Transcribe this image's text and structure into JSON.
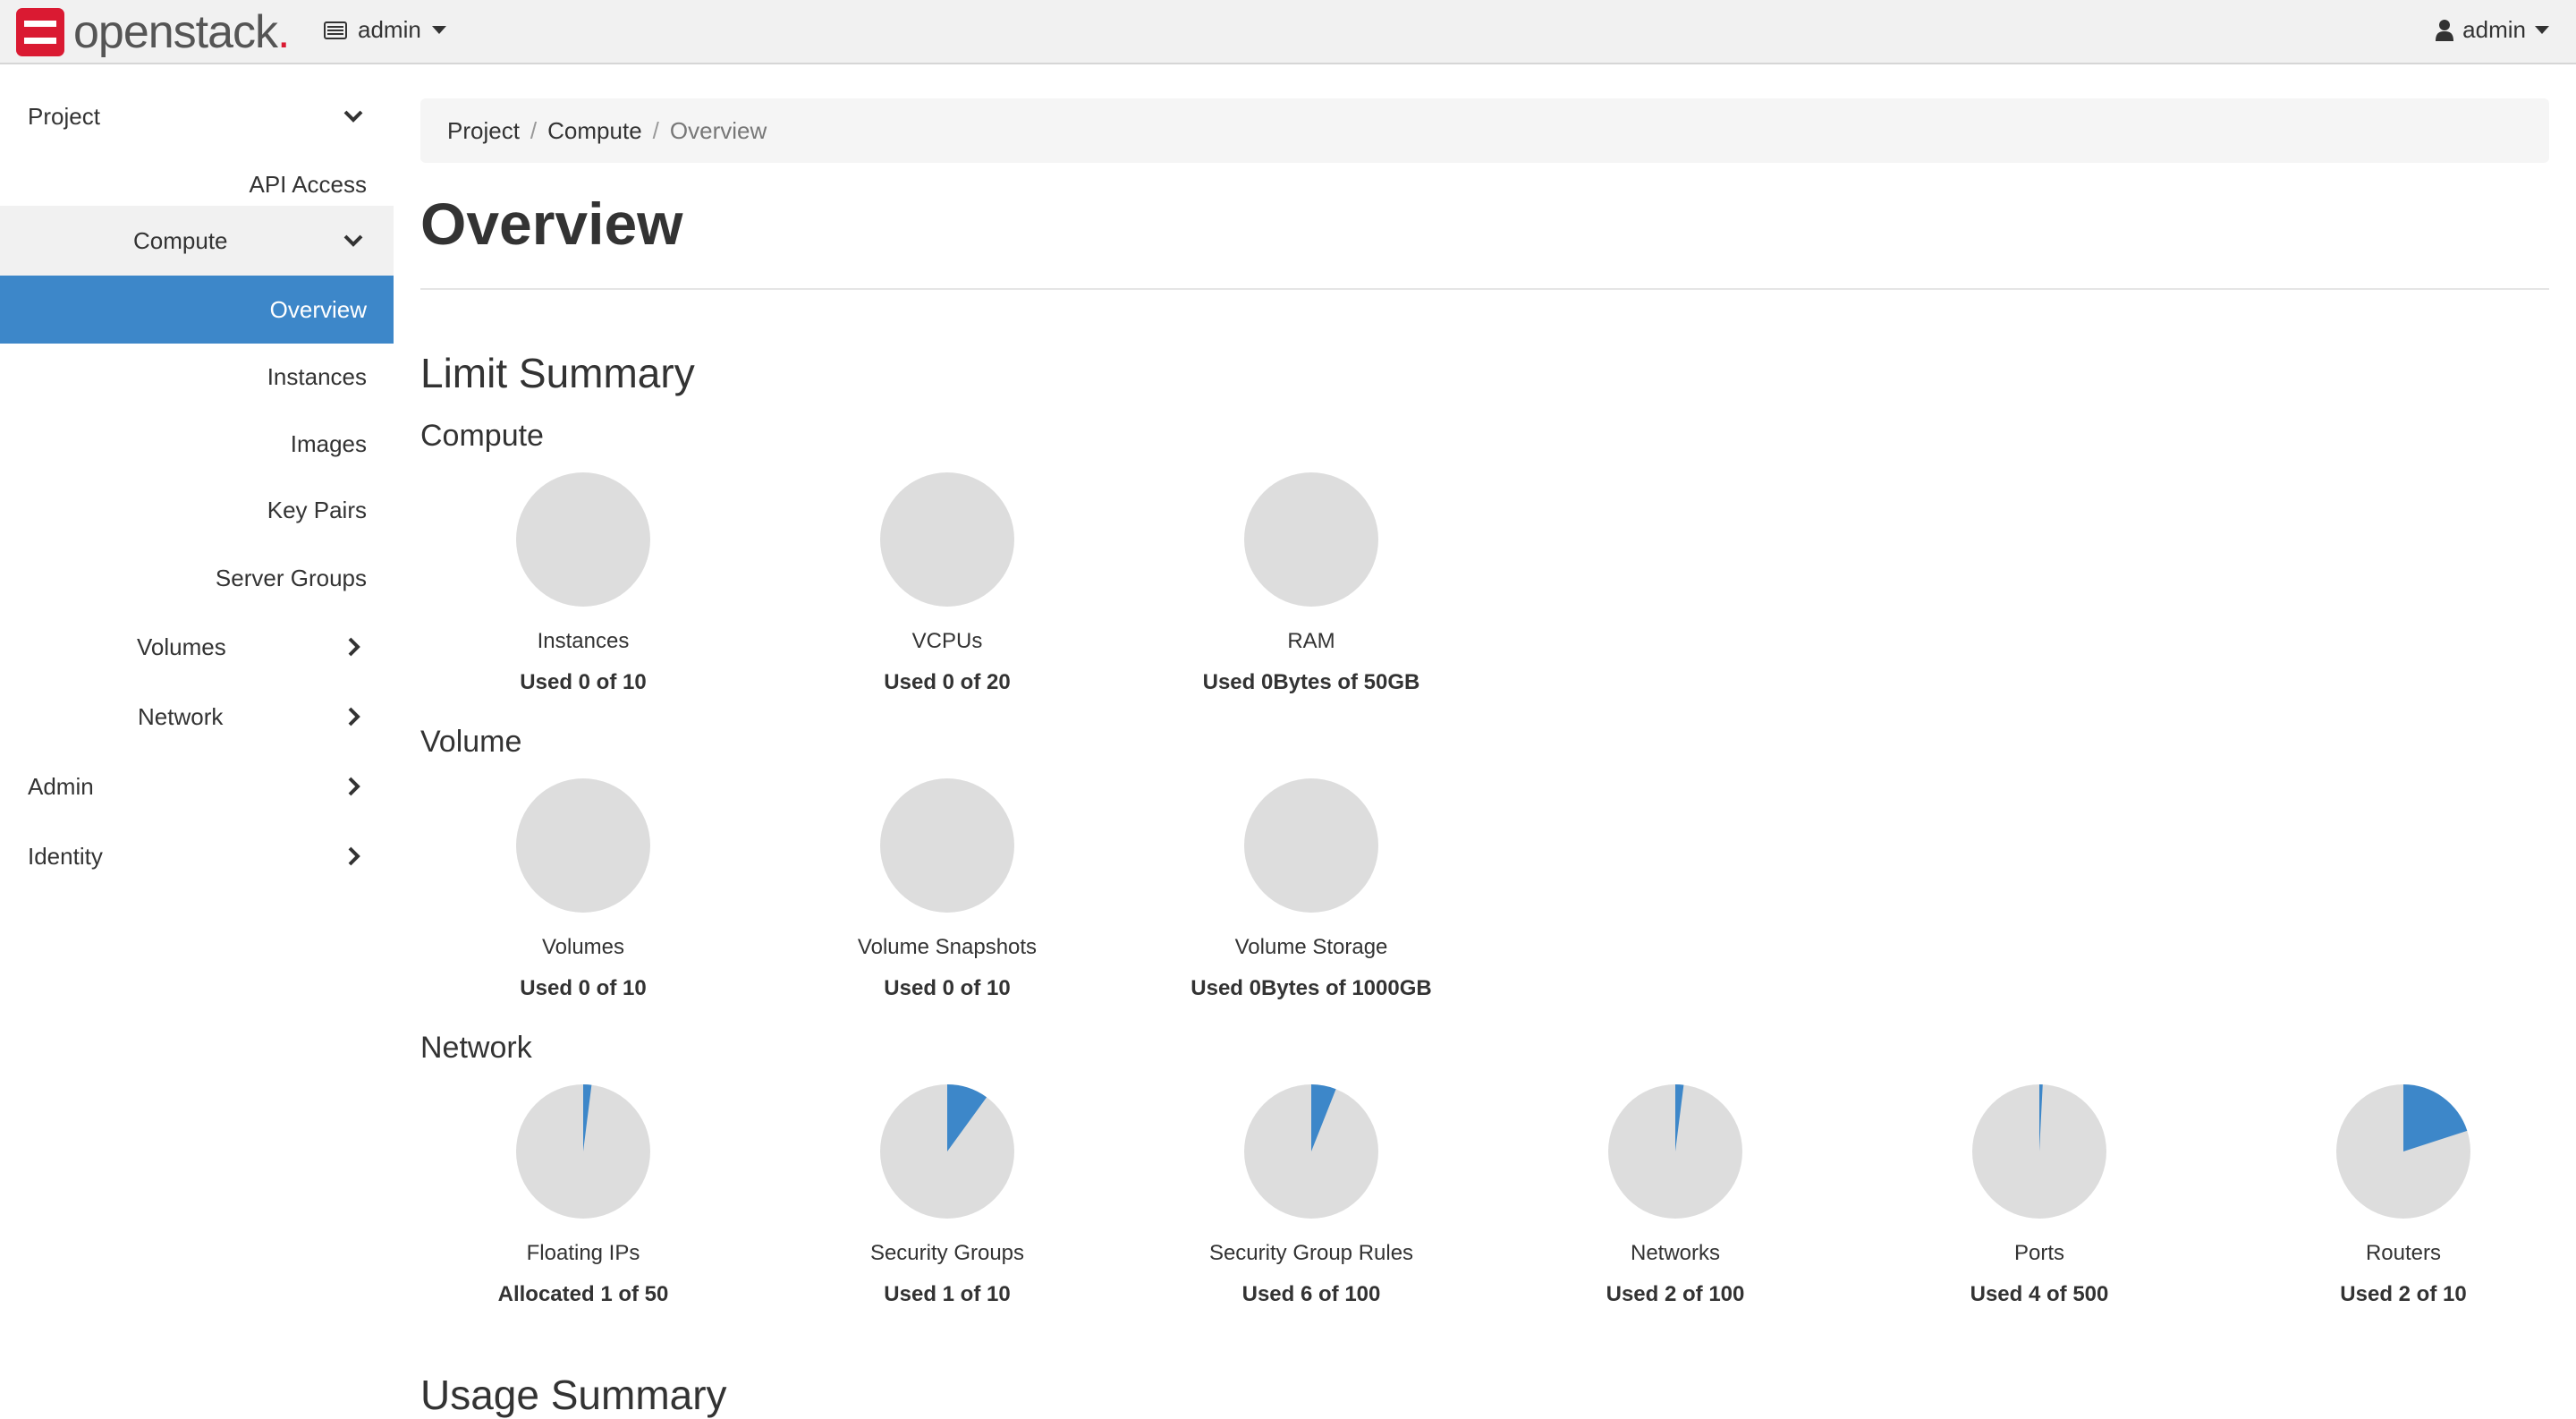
{
  "brand": {
    "name": "openstack",
    "suffix": "."
  },
  "header": {
    "project_switcher": "admin",
    "user_menu": "admin"
  },
  "sidebar": {
    "project": "Project",
    "api_access": "API Access",
    "compute": "Compute",
    "overview": "Overview",
    "instances": "Instances",
    "images": "Images",
    "key_pairs": "Key Pairs",
    "server_groups": "Server Groups",
    "volumes": "Volumes",
    "network": "Network",
    "admin": "Admin",
    "identity": "Identity"
  },
  "breadcrumb": {
    "project": "Project",
    "compute": "Compute",
    "current": "Overview",
    "separator": "/"
  },
  "page_title": "Overview",
  "limit_summary": {
    "heading": "Limit Summary",
    "compute": {
      "heading": "Compute",
      "items": [
        {
          "label": "Instances",
          "used": "Used 0 of 10",
          "fraction": 0
        },
        {
          "label": "VCPUs",
          "used": "Used 0 of 20",
          "fraction": 0
        },
        {
          "label": "RAM",
          "used": "Used 0Bytes of 50GB",
          "fraction": 0
        }
      ]
    },
    "volume": {
      "heading": "Volume",
      "items": [
        {
          "label": "Volumes",
          "used": "Used 0 of 10",
          "fraction": 0
        },
        {
          "label": "Volume Snapshots",
          "used": "Used 0 of 10",
          "fraction": 0
        },
        {
          "label": "Volume Storage",
          "used": "Used 0Bytes of 1000GB",
          "fraction": 0
        }
      ]
    },
    "network": {
      "heading": "Network",
      "items": [
        {
          "label": "Floating IPs",
          "used": "Allocated 1 of 50",
          "fraction": 0.02
        },
        {
          "label": "Security Groups",
          "used": "Used 1 of 10",
          "fraction": 0.1
        },
        {
          "label": "Security Group Rules",
          "used": "Used 6 of 100",
          "fraction": 0.06
        },
        {
          "label": "Networks",
          "used": "Used 2 of 100",
          "fraction": 0.02
        },
        {
          "label": "Ports",
          "used": "Used 4 of 500",
          "fraction": 0.008
        },
        {
          "label": "Routers",
          "used": "Used 2 of 10",
          "fraction": 0.2
        }
      ]
    }
  },
  "usage_summary": {
    "heading": "Usage Summary"
  },
  "colors": {
    "accent": "#3d87c9",
    "pie_bg": "#dddddd",
    "brand_red": "#da1a32"
  }
}
